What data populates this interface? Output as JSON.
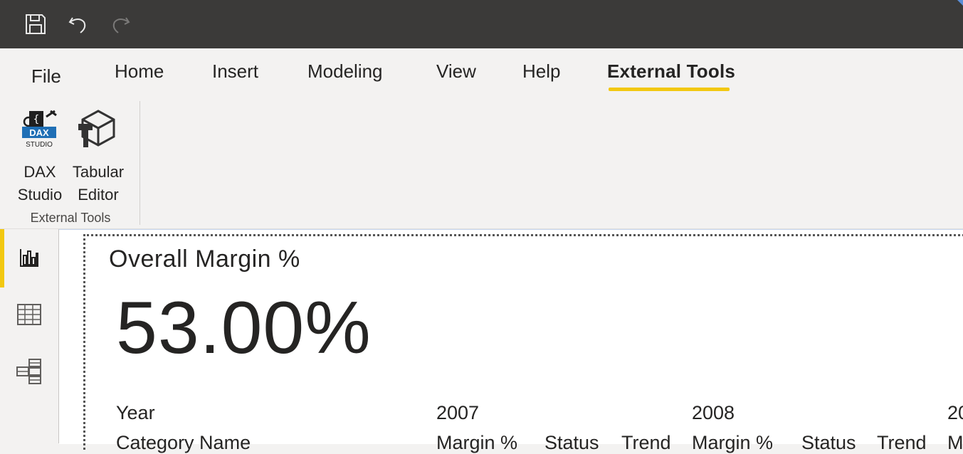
{
  "titlebar": {
    "save_icon": "save-icon",
    "undo_icon": "undo-icon",
    "redo_icon": "redo-icon"
  },
  "tabs": [
    "File",
    "Home",
    "Insert",
    "Modeling",
    "View",
    "Help",
    "External Tools"
  ],
  "active_tab": "External Tools",
  "ribbon": {
    "dax_studio": {
      "line1": "DAX",
      "line2": "Studio",
      "logo_top": "DAX",
      "logo_bottom": "STUDIO"
    },
    "tabular_editor": {
      "line1": "Tabular",
      "line2": "Editor"
    },
    "group_label": "External Tools"
  },
  "rail": [
    "report-view-icon",
    "data-view-icon",
    "model-view-icon"
  ],
  "visual": {
    "title": "Overall Margin %",
    "value": "53.00%",
    "matrix": {
      "row1_label": "Year",
      "row2_label": "Category Name",
      "years": [
        "2007",
        "2008",
        "20"
      ],
      "columns": [
        "Margin %",
        "Status",
        "Trend",
        "Margin %",
        "Status",
        "Trend",
        "M"
      ]
    }
  },
  "colors": {
    "accent": "#f2c811",
    "titlebar": "#3b3a39"
  }
}
